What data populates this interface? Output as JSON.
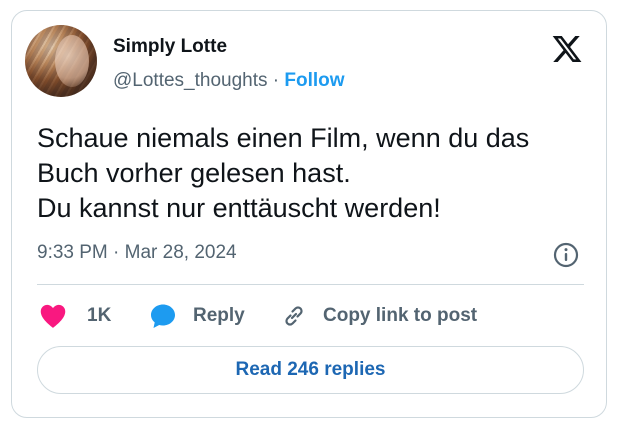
{
  "author": {
    "name": "Simply Lotte",
    "handle": "@Lottes_thoughts",
    "separator": "·",
    "follow_label": "Follow"
  },
  "tweet": {
    "lines": [
      "Schaue niemals einen Film, wenn du das",
      "Buch vorher gelesen hast.",
      "Du kannst nur enttäuscht werden!"
    ],
    "timestamp": "9:33 PM · Mar 28, 2024"
  },
  "actions": {
    "like_count": "1K",
    "reply_label": "Reply",
    "copy_label": "Copy link to post"
  },
  "read_replies_label": "Read 246 replies",
  "icons": {
    "logo": "x-logo-icon",
    "info": "info-icon",
    "like": "heart-icon",
    "reply": "speech-bubble-icon",
    "copy": "link-icon"
  },
  "colors": {
    "accent": "#1d9bf0",
    "like": "#f91880",
    "muted": "#536471",
    "text": "#0f1419",
    "border": "#cfd9de"
  }
}
